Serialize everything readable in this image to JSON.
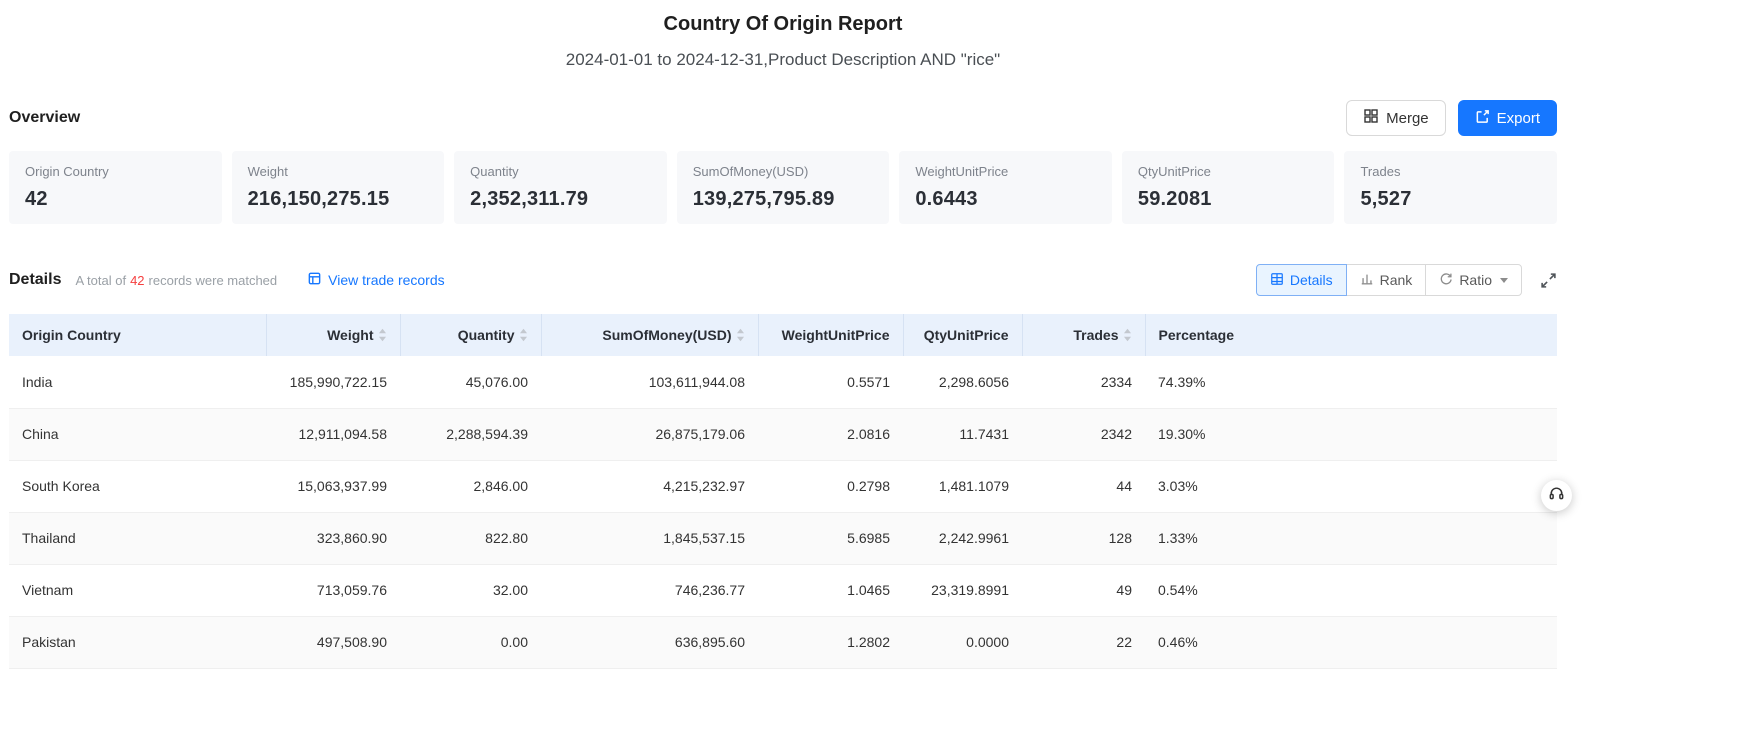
{
  "page": {
    "title": "Country Of Origin Report",
    "subtitle": "2024-01-01 to 2024-12-31,Product Description AND \"rice\""
  },
  "overview": {
    "heading": "Overview",
    "merge_button": "Merge",
    "export_button": "Export",
    "cards": [
      {
        "label": "Origin Country",
        "value": "42"
      },
      {
        "label": "Weight",
        "value": "216,150,275.15"
      },
      {
        "label": "Quantity",
        "value": "2,352,311.79"
      },
      {
        "label": "SumOfMoney(USD)",
        "value": "139,275,795.89"
      },
      {
        "label": "WeightUnitPrice",
        "value": "0.6443"
      },
      {
        "label": "QtyUnitPrice",
        "value": "59.2081"
      },
      {
        "label": "Trades",
        "value": "5,527"
      }
    ]
  },
  "details": {
    "heading": "Details",
    "total_prefix": "A total of",
    "total_count": "42",
    "total_suffix": "records were matched",
    "view_trade_records": "View trade records",
    "toolbar": {
      "details_tab": "Details",
      "rank_tab": "Rank",
      "ratio_tab": "Ratio"
    }
  },
  "table": {
    "columns": [
      {
        "label": "Origin Country",
        "sortable": false
      },
      {
        "label": "Weight",
        "sortable": true
      },
      {
        "label": "Quantity",
        "sortable": true
      },
      {
        "label": "SumOfMoney(USD)",
        "sortable": true
      },
      {
        "label": "WeightUnitPrice",
        "sortable": false
      },
      {
        "label": "QtyUnitPrice",
        "sortable": false
      },
      {
        "label": "Trades",
        "sortable": true
      },
      {
        "label": "Percentage",
        "sortable": false
      }
    ],
    "rows": [
      {
        "origin_country": "India",
        "weight": "185,990,722.15",
        "quantity": "45,076.00",
        "sum_of_money_usd": "103,611,944.08",
        "weight_unit_price": "0.5571",
        "qty_unit_price": "2,298.6056",
        "trades": "2334",
        "percentage": "74.39%"
      },
      {
        "origin_country": "China",
        "weight": "12,911,094.58",
        "quantity": "2,288,594.39",
        "sum_of_money_usd": "26,875,179.06",
        "weight_unit_price": "2.0816",
        "qty_unit_price": "11.7431",
        "trades": "2342",
        "percentage": "19.30%"
      },
      {
        "origin_country": "South Korea",
        "weight": "15,063,937.99",
        "quantity": "2,846.00",
        "sum_of_money_usd": "4,215,232.97",
        "weight_unit_price": "0.2798",
        "qty_unit_price": "1,481.1079",
        "trades": "44",
        "percentage": "3.03%"
      },
      {
        "origin_country": "Thailand",
        "weight": "323,860.90",
        "quantity": "822.80",
        "sum_of_money_usd": "1,845,537.15",
        "weight_unit_price": "5.6985",
        "qty_unit_price": "2,242.9961",
        "trades": "128",
        "percentage": "1.33%"
      },
      {
        "origin_country": "Vietnam",
        "weight": "713,059.76",
        "quantity": "32.00",
        "sum_of_money_usd": "746,236.77",
        "weight_unit_price": "1.0465",
        "qty_unit_price": "23,319.8991",
        "trades": "49",
        "percentage": "0.54%"
      },
      {
        "origin_country": "Pakistan",
        "weight": "497,508.90",
        "quantity": "0.00",
        "sum_of_money_usd": "636,895.60",
        "weight_unit_price": "1.2802",
        "qty_unit_price": "0.0000",
        "trades": "22",
        "percentage": "0.46%"
      }
    ]
  },
  "colors": {
    "accent_blue": "#1677ff",
    "count_red": "#f53f3f",
    "table_header_bg": "#e9f1fc",
    "card_bg": "#f7f8fa"
  }
}
